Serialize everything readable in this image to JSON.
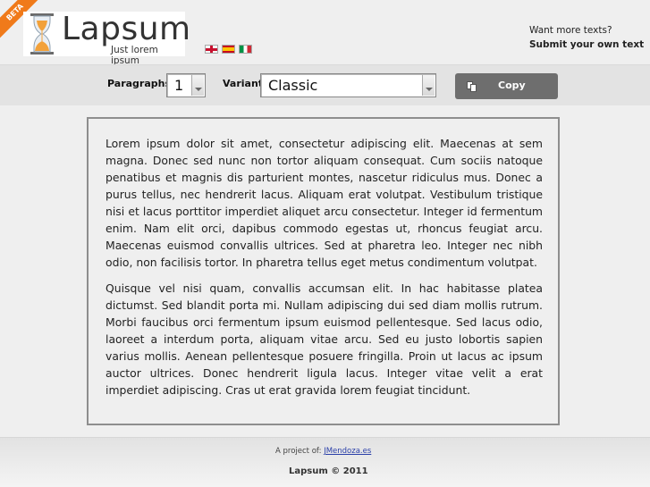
{
  "header": {
    "beta": "BETA",
    "logo_title": "Lapsum",
    "logo_subtitle": "Just lorem ipsum",
    "languages": [
      "English",
      "Español",
      "Italiano"
    ],
    "want_more": "Want more texts?",
    "submit": "Submit your own text"
  },
  "toolbar": {
    "paragraphs_label": "Paragraphs",
    "paragraphs_value": "1",
    "variant_label": "Variant",
    "variant_value": "Classic",
    "copy_label": "Copy"
  },
  "content": {
    "paragraphs": [
      "Lorem ipsum dolor sit amet, consectetur adipiscing elit. Maecenas at sem magna. Donec sed nunc non tortor aliquam consequat. Cum sociis natoque penatibus et magnis dis parturient montes, nascetur ridiculus mus. Donec a purus tellus, nec hendrerit lacus. Aliquam erat volutpat. Vestibulum tristique nisi et lacus porttitor imperdiet aliquet arcu consectetur. Integer id fermentum enim. Nam elit orci, dapibus commodo egestas ut, rhoncus feugiat arcu. Maecenas euismod convallis ultrices. Sed at pharetra leo. Integer nec nibh odio, non facilisis tortor. In pharetra tellus eget metus condimentum volutpat.",
      "Quisque vel nisi quam, convallis accumsan elit. In hac habitasse platea dictumst. Sed blandit porta mi. Nullam adipiscing dui sed diam mollis rutrum. Morbi faucibus orci fermentum ipsum euismod pellentesque. Sed lacus odio, laoreet a interdum porta, aliquam vitae arcu. Sed eu justo lobortis sapien varius mollis. Aenean pellentesque posuere fringilla. Proin ut lacus ac ipsum auctor ultrices. Donec hendrerit ligula lacus. Integer vitae velit a erat imperdiet adipiscing. Cras ut erat gravida lorem feugiat tincidunt."
    ]
  },
  "footer": {
    "project_prefix": "A project of:",
    "project_link": "JMendoza.es",
    "copyright": "Lapsum © 2011"
  },
  "colors": {
    "accent_orange": "#f07a1a",
    "copy_button": "#6e6e6e",
    "link": "#2a3fa8"
  }
}
